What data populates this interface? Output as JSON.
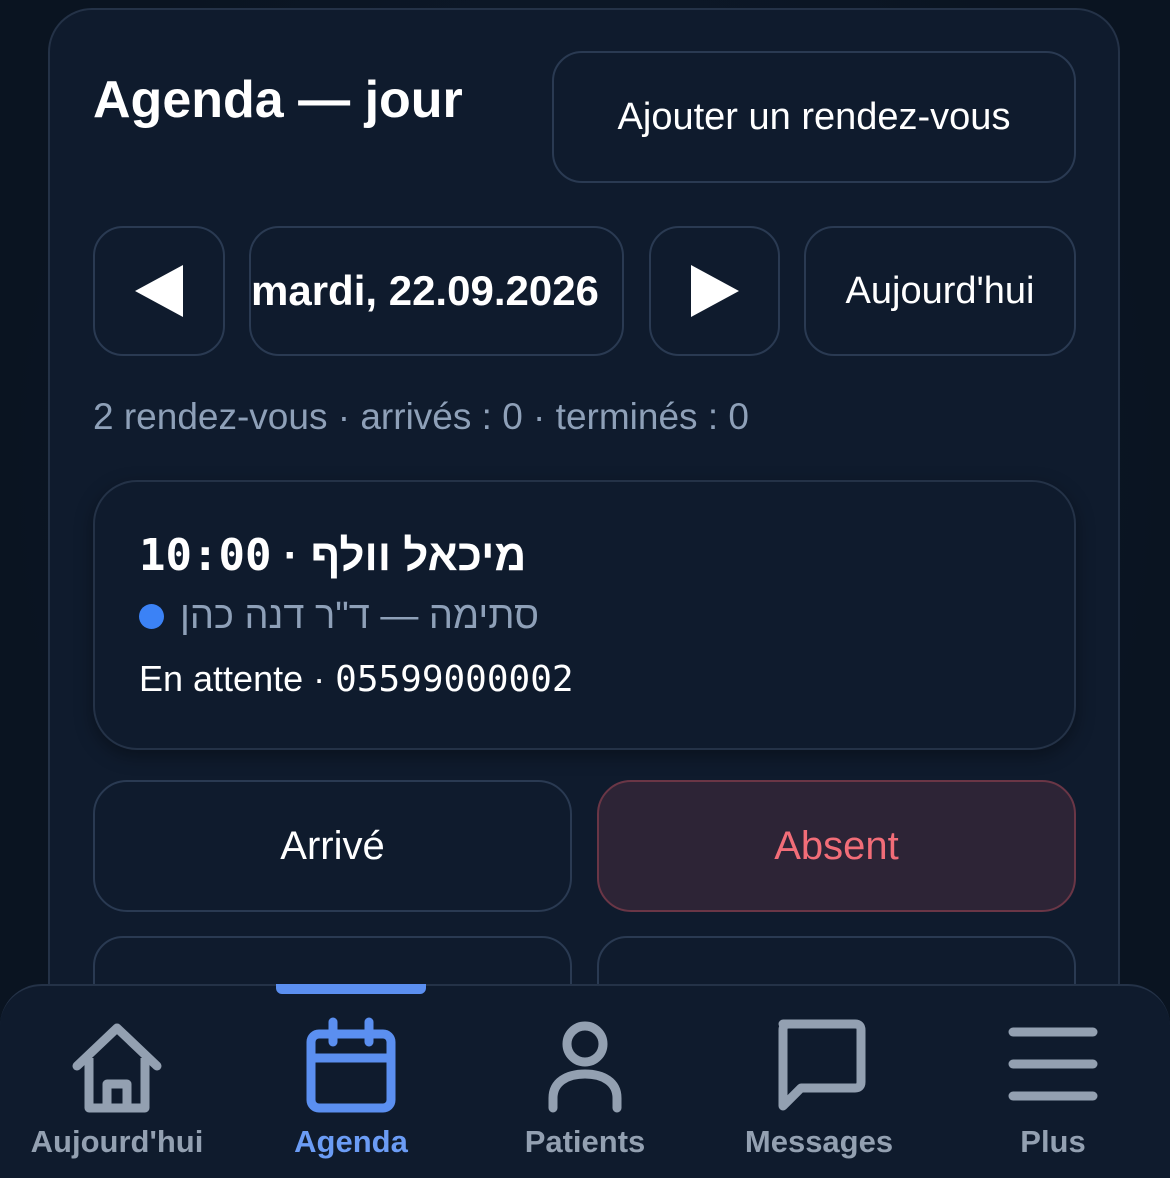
{
  "header": {
    "title": "Agenda — jour",
    "add_button": "Ajouter un rendez-vous"
  },
  "date_nav": {
    "prev_icon": "triangle-left-icon",
    "date": "mardi, 22.09.2026",
    "next_icon": "triangle-right-icon",
    "today_button": "Aujourd'hui"
  },
  "summary": "2 rendez-vous · arrivés : 0 · terminés : 0",
  "appointment": {
    "time": "10:00",
    "separator": " · ",
    "patient": "מיכאל וולף",
    "type_doctor": "סתימה — ד\"ר דנה כהן",
    "status": "En attente",
    "phone": "05599000002",
    "dot_color": "#3b82f6"
  },
  "actions": {
    "arrived": "Arrivé",
    "absent": "Absent"
  },
  "bottom_nav": {
    "items": [
      {
        "label": "Aujourd'hui",
        "icon": "home-icon"
      },
      {
        "label": "Agenda",
        "icon": "calendar-icon",
        "active": true
      },
      {
        "label": "Patients",
        "icon": "user-icon"
      },
      {
        "label": "Messages",
        "icon": "chat-icon"
      },
      {
        "label": "Plus",
        "icon": "menu-icon"
      }
    ]
  },
  "colors": {
    "background": "#0b1523",
    "panel": "#0f1b2d",
    "accent": "#5b8ff0",
    "muted_text": "#8ea0b8",
    "absent_text": "#f26d78"
  }
}
